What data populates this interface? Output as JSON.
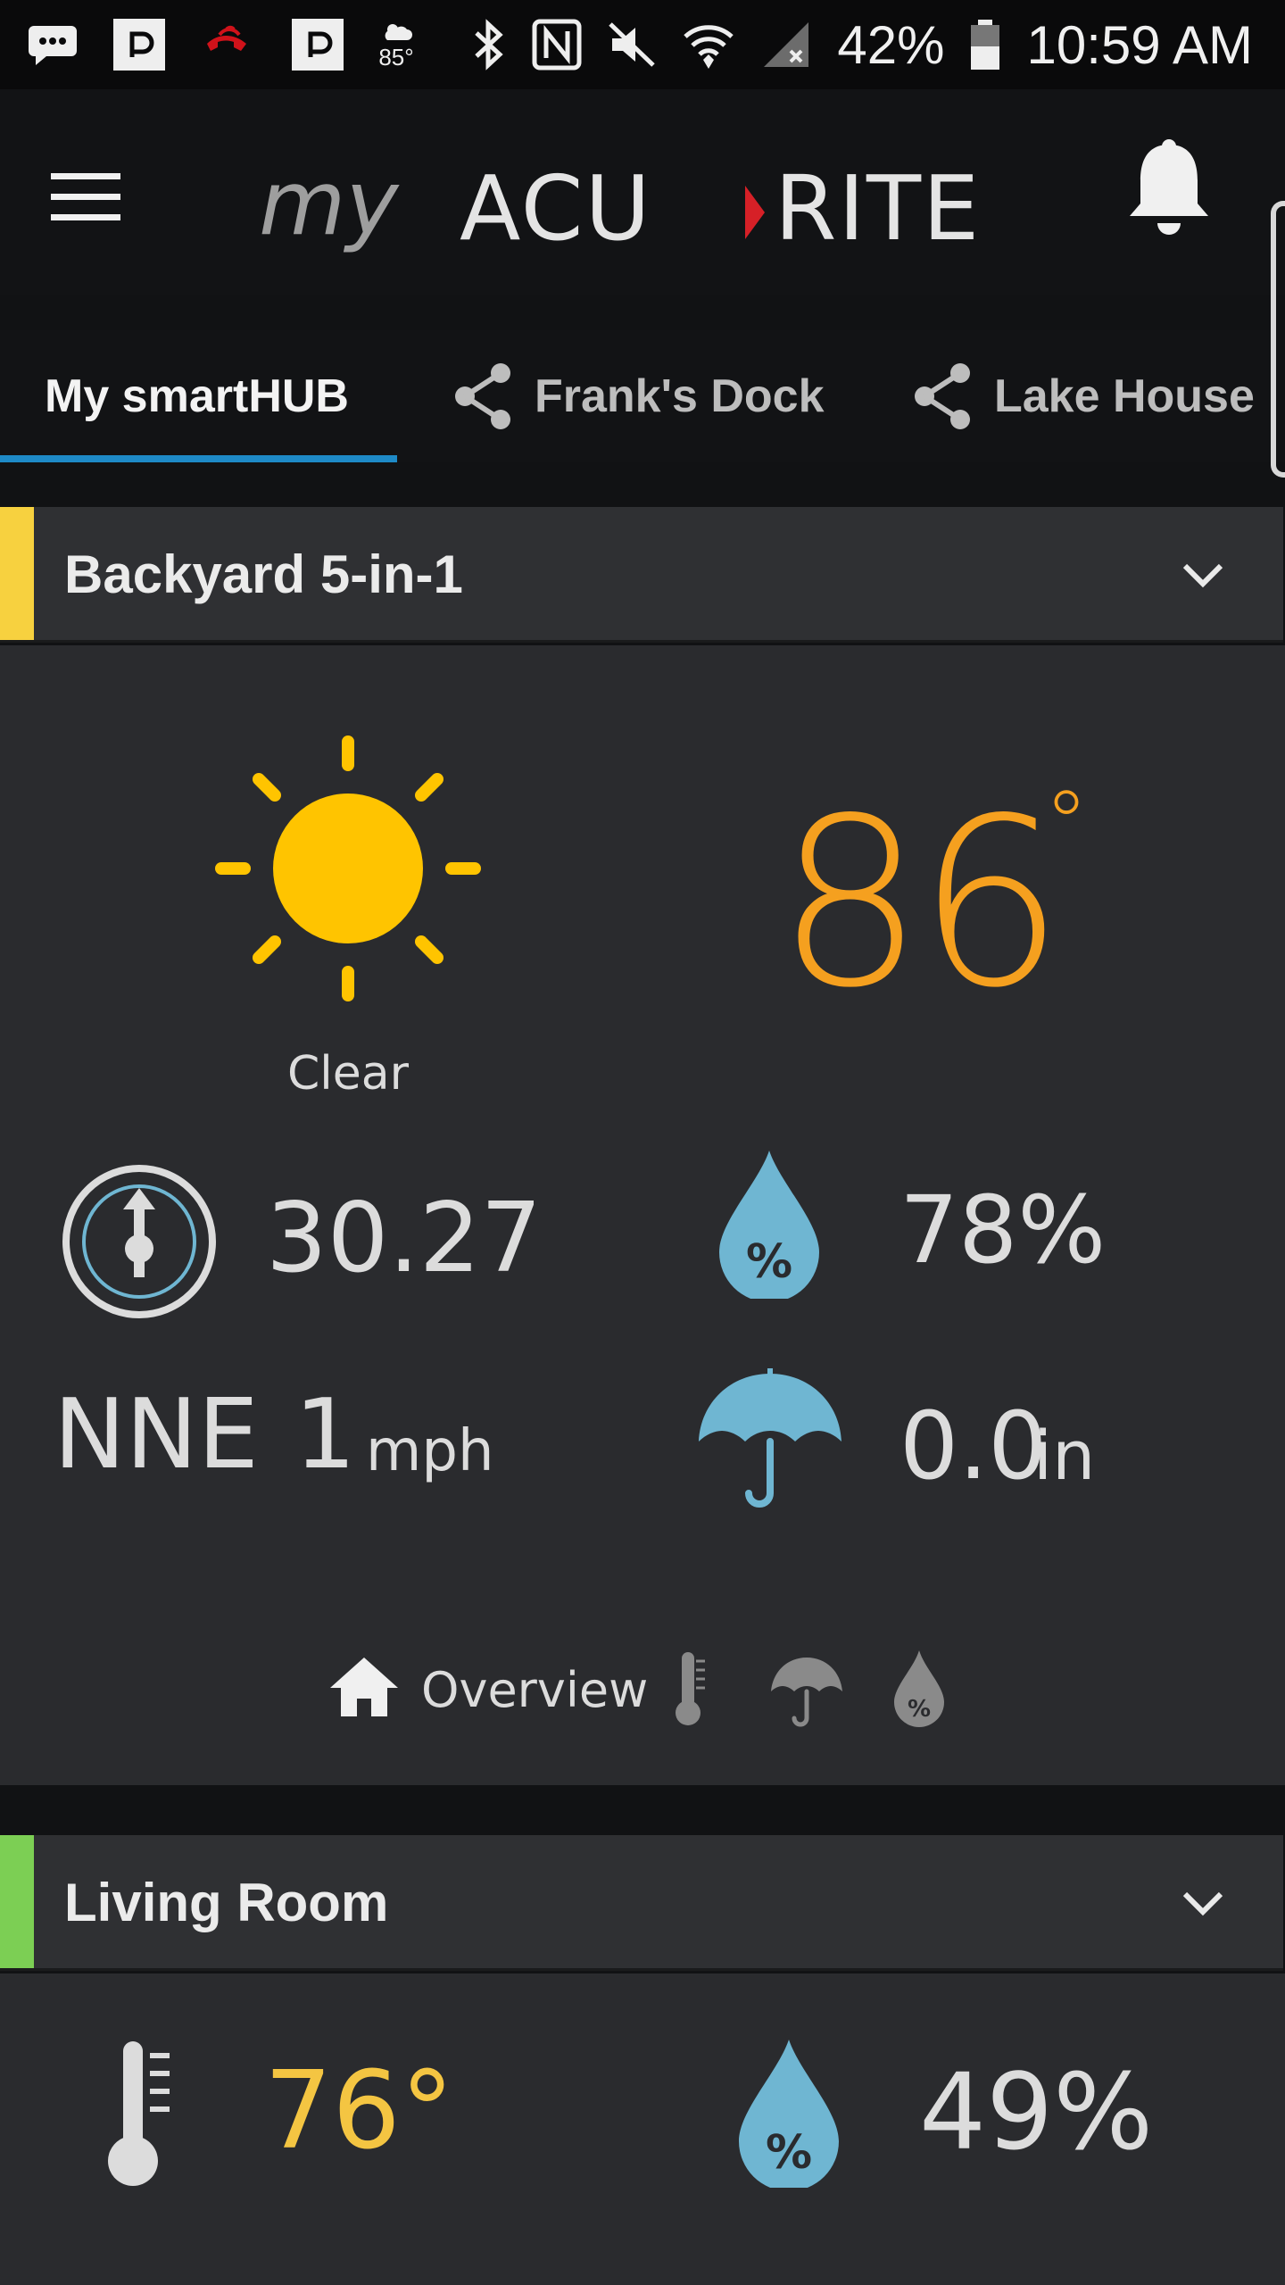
{
  "status_bar": {
    "weather_temp": "85°",
    "battery": "42%",
    "time": "10:59 AM"
  },
  "app": {
    "logo_text_my": "my",
    "logo_text_acu": "ACU",
    "logo_text_rite": "RITE"
  },
  "tabs": [
    {
      "label": "My smartHUB",
      "active": true,
      "shared": false
    },
    {
      "label": "Frank's Dock",
      "active": false,
      "shared": true
    },
    {
      "label": "Lake House",
      "active": false,
      "shared": true
    }
  ],
  "cards": [
    {
      "title": "Backyard 5-in-1",
      "accent_color": "#f7d13f",
      "condition": "Clear",
      "temperature": "86",
      "temperature_unit": "°",
      "pressure": "30.27",
      "humidity": "78%",
      "wind_direction": "NNE",
      "wind_speed": "1",
      "wind_unit": "mph",
      "rain": "0.0",
      "rain_unit": "in",
      "views": {
        "overview_label": "Overview"
      }
    },
    {
      "title": "Living Room",
      "accent_color": "#7ccf54",
      "temperature": "76°",
      "humidity": "49%"
    }
  ],
  "colors": {
    "temperature_orange": "#f5a01f",
    "indoor_temp_yellow": "#f4c542",
    "sun_yellow": "#ffc400",
    "water_blue": "#6fb6d2",
    "tab_underline": "#1e8ac7",
    "logo_arrow_red": "#d62027"
  },
  "icons": [
    "chat-icon",
    "pocket-icon",
    "missed-call-icon",
    "weather-icon",
    "bluetooth-icon",
    "nfc-icon",
    "mute-icon",
    "wifi-icon",
    "signal-icon",
    "battery-icon",
    "menu-icon",
    "bell-icon",
    "share-icon",
    "chevron-down-icon",
    "sun-icon",
    "barometer-icon",
    "humidity-icon",
    "umbrella-icon",
    "home-icon",
    "thermometer-icon"
  ]
}
